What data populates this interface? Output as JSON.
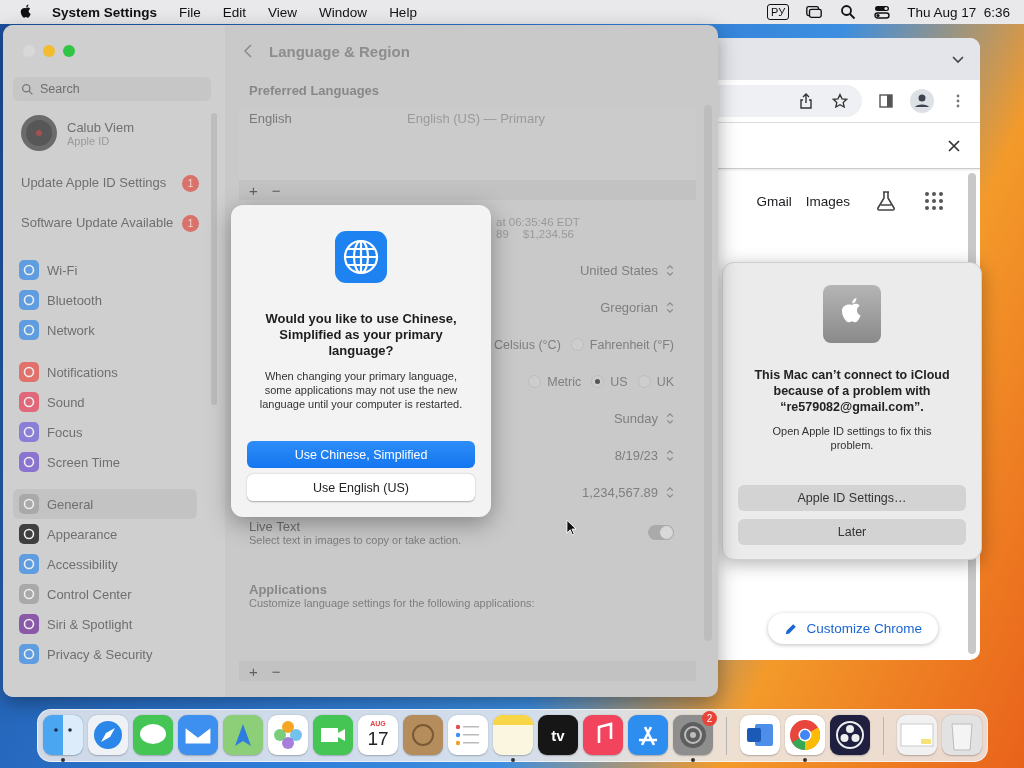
{
  "menu_bar": {
    "app_name": "System Settings",
    "menus": [
      "File",
      "Edit",
      "View",
      "Window",
      "Help"
    ],
    "input_source": "РУ",
    "clock": "Thu Aug 17  6:36"
  },
  "browser": {
    "links": [
      "Gmail",
      "Images"
    ],
    "customize_button": "Customize Chrome"
  },
  "settings": {
    "title": "Language & Region",
    "search_placeholder": "Search",
    "account": {
      "name": "Calub Viem",
      "subtitle": "Apple ID"
    },
    "alerts": [
      {
        "label": "Update Apple ID Settings",
        "badge": "1"
      },
      {
        "label": "Software Update Available",
        "badge": "1"
      }
    ],
    "sidebar_groups": [
      [
        {
          "label": "Wi-Fi",
          "color": "#5f9de0",
          "selected": false
        },
        {
          "label": "Bluetooth",
          "color": "#5f9de0",
          "selected": false
        },
        {
          "label": "Network",
          "color": "#5f9de0",
          "selected": false
        }
      ],
      [
        {
          "label": "Notifications",
          "color": "#e0716b",
          "selected": false
        },
        {
          "label": "Sound",
          "color": "#e0687a",
          "selected": false
        },
        {
          "label": "Focus",
          "color": "#8a7fd6",
          "selected": false
        },
        {
          "label": "Screen Time",
          "color": "#8a74cf",
          "selected": false
        }
      ],
      [
        {
          "label": "General",
          "color": "#a9a9a9",
          "selected": true
        },
        {
          "label": "Appearance",
          "color": "#3f3f3f",
          "selected": false
        },
        {
          "label": "Accessibility",
          "color": "#5f9de0",
          "selected": false
        },
        {
          "label": "Control Center",
          "color": "#a9a9a9",
          "selected": false
        },
        {
          "label": "Siri & Spotlight",
          "color": "#8a5aa8",
          "selected": false
        },
        {
          "label": "Privacy & Security",
          "color": "#5f9de0",
          "selected": false
        }
      ]
    ],
    "preferred_languages": {
      "heading": "Preferred Languages",
      "languages": [
        {
          "name": "English",
          "detail": "English (US) — Primary"
        }
      ],
      "controls": [
        "+",
        "−"
      ]
    },
    "preview": [
      "at 06:35:46 EDT",
      "89",
      "$1,234.56"
    ],
    "rows": [
      {
        "kind": "popup",
        "value": "United States"
      },
      {
        "kind": "popup",
        "value": "Gregorian"
      },
      {
        "kind": "radio",
        "partial_label": "Celsius (°C)",
        "options": [
          {
            "label": "Fahrenheit (°F)",
            "selected": false
          }
        ]
      },
      {
        "kind": "radio",
        "options": [
          {
            "label": "Metric",
            "selected": false
          },
          {
            "label": "US",
            "selected": true
          },
          {
            "label": "UK",
            "selected": false
          }
        ]
      },
      {
        "kind": "popup",
        "value": "Sunday"
      },
      {
        "kind": "popup",
        "value": "8/19/23"
      },
      {
        "kind": "popup",
        "value": "1,234,567.89"
      }
    ],
    "live_text": {
      "title": "Live Text",
      "description": "Select text in images to copy or take action.",
      "on": true
    },
    "applications": {
      "heading": "Applications",
      "description": "Customize language settings for the following applications:",
      "controls": [
        "+",
        "−"
      ]
    }
  },
  "dialog": {
    "title": "Would you like to use Chinese, Simplified as your primary language?",
    "message": "When changing your primary language, some applications may not use the new language until your computer is restarted.",
    "buttons": [
      {
        "label": "Use Chinese, Simplified",
        "kind": "primary"
      },
      {
        "label": "Use English (US)",
        "kind": "secondary"
      }
    ]
  },
  "icloud_alert": {
    "title": "This Mac can’t connect to iCloud because of a problem with “re579082@gmail.com”.",
    "message": "Open Apple ID settings to fix this problem.",
    "buttons": [
      "Apple ID Settings…",
      "Later"
    ]
  },
  "dock": {
    "items": [
      {
        "kind": "finder",
        "running": true
      },
      {
        "kind": "safari",
        "running": false
      },
      {
        "kind": "messages",
        "running": false
      },
      {
        "kind": "mail",
        "running": false
      },
      {
        "kind": "maps",
        "running": false
      },
      {
        "kind": "photos",
        "running": false
      },
      {
        "kind": "facetime",
        "running": false
      },
      {
        "kind": "calendar",
        "running": false,
        "month": "AUG",
        "day": "17"
      },
      {
        "kind": "contacts",
        "running": false
      },
      {
        "kind": "reminders",
        "running": false
      },
      {
        "kind": "notes",
        "running": true
      },
      {
        "kind": "tv",
        "running": false,
        "label": "tv"
      },
      {
        "kind": "music",
        "running": false
      },
      {
        "kind": "appstore",
        "running": false
      },
      {
        "kind": "settings",
        "running": true,
        "badge": "2"
      },
      {
        "kind": "separator"
      },
      {
        "kind": "word",
        "running": false
      },
      {
        "kind": "chrome",
        "running": true
      },
      {
        "kind": "obs",
        "running": false
      },
      {
        "kind": "separator"
      },
      {
        "kind": "folder",
        "running": false
      },
      {
        "kind": "trash",
        "running": false
      }
    ]
  }
}
